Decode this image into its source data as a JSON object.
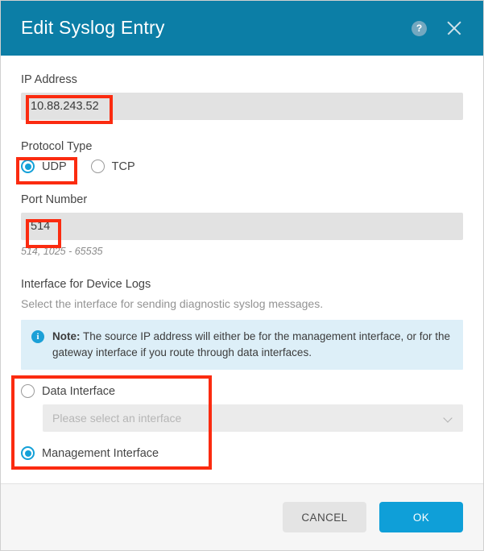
{
  "header": {
    "title": "Edit Syslog Entry",
    "help_icon": "question-mark-icon",
    "close_icon": "close-icon",
    "bg_color": "#0c7ea6"
  },
  "form": {
    "ip_address": {
      "label": "IP Address",
      "value": "10.88.243.52"
    },
    "protocol_type": {
      "label": "Protocol Type",
      "options": [
        {
          "label": "UDP",
          "selected": true
        },
        {
          "label": "TCP",
          "selected": false
        }
      ]
    },
    "port_number": {
      "label": "Port Number",
      "value": "514",
      "helper": "514, 1025 - 65535"
    },
    "interface_section": {
      "label": "Interface for Device Logs",
      "description": "Select the interface for sending diagnostic syslog messages.",
      "note": {
        "icon": "info-icon",
        "prefix": "Note:",
        "text": "The source IP address will either be for the management interface, or for the gateway interface if you route through data interfaces."
      },
      "options": [
        {
          "label": "Data Interface",
          "selected": false
        },
        {
          "label": "Management Interface",
          "selected": true
        }
      ],
      "dropdown": {
        "placeholder": "Please select an interface",
        "value": "",
        "chevron_icon": "chevron-down-icon",
        "disabled": true
      }
    }
  },
  "footer": {
    "cancel_label": "CANCEL",
    "ok_label": "OK",
    "ok_color": "#0f9fd8"
  },
  "annotations": {
    "color": "#fb2b10",
    "boxes": [
      "ip-address-value",
      "udp-radio",
      "port-number-value",
      "interface-radio-group"
    ]
  }
}
